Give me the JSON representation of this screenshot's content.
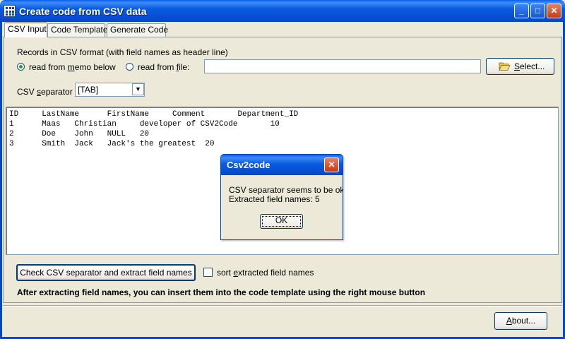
{
  "window": {
    "title": "Create code from CSV data",
    "minimize_glyph": "_",
    "maximize_glyph": "□",
    "close_glyph": "✕"
  },
  "tabs": [
    {
      "label": "CSV Input",
      "active": true
    },
    {
      "label": "Code Template",
      "active": false
    },
    {
      "label": "Generate Code",
      "active": false
    }
  ],
  "csv_input": {
    "records_label": "Records in CSV format (with field names as header line)",
    "radio_memo_pre": "read from ",
    "radio_memo_ul": "m",
    "radio_memo_post": "emo below",
    "radio_file_pre": "read from ",
    "radio_file_ul": "f",
    "radio_file_post": "ile:",
    "file_path_value": "",
    "select_button_ul": "S",
    "select_button_post": "elect...",
    "separator_label_pre": "CSV ",
    "separator_label_ul": "s",
    "separator_label_post": "eparator",
    "separator_value": "[TAB]",
    "memo_lines": [
      "ID     LastName      FirstName     Comment       Department_ID",
      "1      Maas   Christian     developer of CSV2Code       10",
      "2      Doe    John   NULL   20",
      "3      Smith  Jack   Jack's the greatest  20"
    ],
    "check_button_label": "Check CSV separator and extract field names",
    "sort_label_pre": "sort ",
    "sort_label_ul": "e",
    "sort_label_post": "xtracted field names",
    "note": "After extracting field names, you can insert them into the code template using the right mouse button"
  },
  "about_button_ul": "A",
  "about_button_post": "bout...",
  "dialog": {
    "title": "Csv2code",
    "message_line1": "CSV separator seems to be ok.",
    "message_line2": "Extracted field names: 5",
    "ok_label": "OK",
    "close_glyph": "✕"
  },
  "colors": {
    "titlebar": "#0447C9",
    "dialog_close": "#C73A12",
    "tab_highlight": "#F8A700"
  },
  "icons": {
    "app": "grid-app-icon",
    "folder": "open-folder-icon",
    "dropdown": "chevron-down-icon"
  }
}
